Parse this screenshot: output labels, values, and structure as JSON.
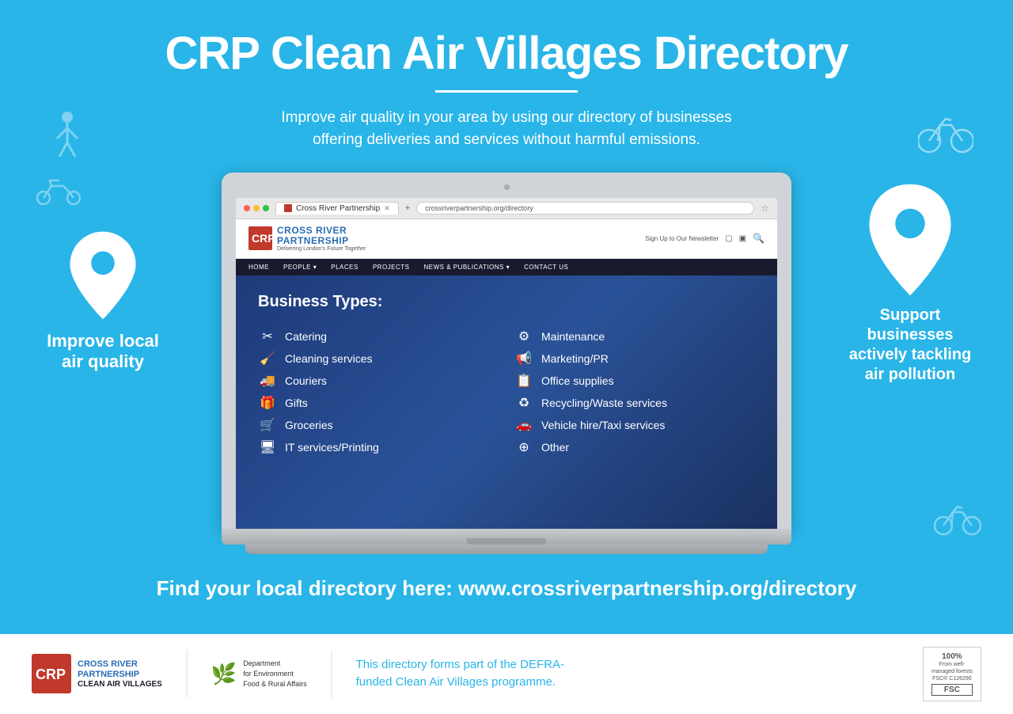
{
  "header": {
    "title": "CRP Clean Air Villages Directory",
    "subtitle_line1": "Improve air quality in your area by using our directory of businesses",
    "subtitle_line2": "offering deliveries and services without harmful emissions."
  },
  "left_pin": {
    "text_line1": "Improve local",
    "text_line2": "air quality"
  },
  "right_pin": {
    "text_line1": "Support",
    "text_line2": "businesses",
    "text_line3": "actively tackling",
    "text_line4": "air pollution"
  },
  "browser": {
    "tab_label": "Cross River Partnership",
    "url": "crossriverpartnership.org/directory",
    "nav_items": [
      "HOME",
      "PEOPLE ▾",
      "PLACES",
      "PROJECTS",
      "NEWS & PUBLICATIONS ▾",
      "CONTACT US"
    ],
    "logo_main": "CROSS RIVER\nPARTNERSHIP",
    "logo_sub": "Delivering London's Future Together",
    "newsletter_text": "Sign Up to Our Newsletter",
    "content_title": "Business Types:"
  },
  "business_items_left": [
    {
      "icon": "✂",
      "label": "Catering"
    },
    {
      "icon": "🧹",
      "label": "Cleaning services"
    },
    {
      "icon": "🚚",
      "label": "Couriers"
    },
    {
      "icon": "🎁",
      "label": "Gifts"
    },
    {
      "icon": "🛒",
      "label": "Groceries"
    },
    {
      "icon": "🖥",
      "label": "IT services/Printing"
    }
  ],
  "business_items_right": [
    {
      "icon": "⚙",
      "label": "Maintenance"
    },
    {
      "icon": "📢",
      "label": "Marketing/PR"
    },
    {
      "icon": "📋",
      "label": "Office supplies"
    },
    {
      "icon": "♻",
      "label": "Recycling/Waste services"
    },
    {
      "icon": "🚗",
      "label": "Vehicle hire/Taxi services"
    },
    {
      "icon": "⊕",
      "label": "Other"
    }
  ],
  "find_url": {
    "text": "Find your local directory here: www.crossriverpartnership.org/directory"
  },
  "footer": {
    "logo_main": "CROSS RIVER\nPARTNERSHIP",
    "logo_sub": "CLEAN AIR VILLAGES",
    "defra_line1": "Department",
    "defra_line2": "for Environment",
    "defra_line3": "Food & Rural Affairs",
    "desc_line1": "This directory forms part of the DEFRA-",
    "desc_line2": "funded Clean Air Villages programme.",
    "fsc_pct": "100%",
    "fsc_line1": "From well-",
    "fsc_line2": "managed forests",
    "fsc_cert": "FSC® C126290"
  }
}
